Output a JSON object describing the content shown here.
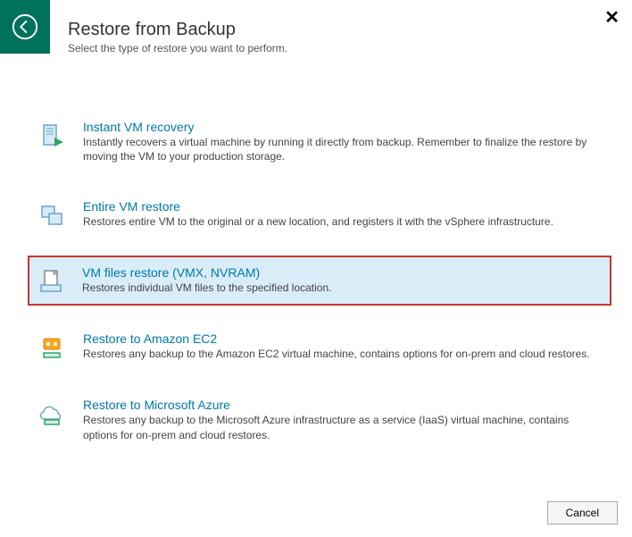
{
  "header": {
    "title": "Restore from Backup",
    "subtitle": "Select the type of restore you want to perform."
  },
  "options": [
    {
      "id": "instant",
      "title": "Instant VM recovery",
      "desc": "Instantly recovers a virtual machine by running it directly from backup. Remember to finalize the restore by moving the VM to your production storage.",
      "selected": false
    },
    {
      "id": "entire",
      "title": "Entire VM restore",
      "desc": "Restores entire VM to the original or a new location, and registers it with the vSphere infrastructure.",
      "selected": false
    },
    {
      "id": "vmfiles",
      "title": "VM files restore (VMX, NVRAM)",
      "desc": "Restores individual VM files to the specified location.",
      "selected": true
    },
    {
      "id": "ec2",
      "title": "Restore to Amazon EC2",
      "desc": "Restores any backup to the Amazon EC2 virtual machine, contains options for on-prem and cloud restores.",
      "selected": false
    },
    {
      "id": "azure",
      "title": "Restore to Microsoft Azure",
      "desc": "Restores any backup to the Microsoft Azure infrastructure as a service (IaaS) virtual machine, contains options for on-prem and cloud restores.",
      "selected": false
    }
  ],
  "footer": {
    "cancel": "Cancel"
  }
}
